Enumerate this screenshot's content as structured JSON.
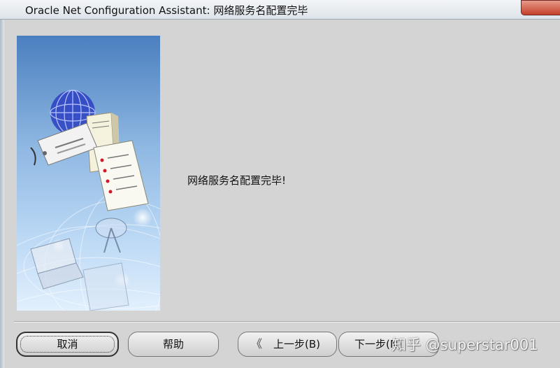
{
  "window": {
    "title": "Oracle Net Configuration Assistant: 网络服务名配置完毕"
  },
  "content": {
    "message": "网络服务名配置完毕!"
  },
  "buttons": {
    "cancel": "取消",
    "help": "帮助",
    "back": "上一步(B)",
    "next": "下一步(N)"
  },
  "icons": {
    "back_arrow": "《"
  },
  "watermark": {
    "text": "知乎 @superstar001"
  },
  "colors": {
    "window_bg": "#d4d4d4",
    "banner_top": "#4a7fbf",
    "banner_bottom": "#e2f0fd",
    "close_button": "#c4402b"
  }
}
